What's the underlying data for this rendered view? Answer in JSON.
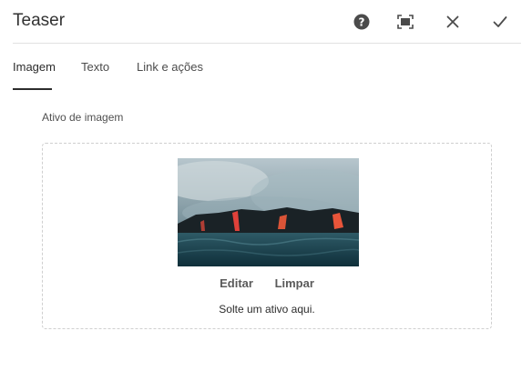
{
  "dialog": {
    "title": "Teaser",
    "buttons": {
      "help": "help-icon",
      "fullscreen": "fullscreen-icon",
      "cancel": "close-icon",
      "confirm": "check-icon"
    }
  },
  "tabs": [
    {
      "label": "Imagem",
      "active": true
    },
    {
      "label": "Texto",
      "active": false
    },
    {
      "label": "Link e ações",
      "active": false
    }
  ],
  "image_field": {
    "label": "Ativo de imagem",
    "edit_label": "Editar",
    "clear_label": "Limpar",
    "drop_hint": "Solte um ativo aqui."
  },
  "colors": {
    "accent": "#2c2c2c",
    "divider": "#e1e1e1",
    "dropzone_border": "#cfcfcf"
  }
}
